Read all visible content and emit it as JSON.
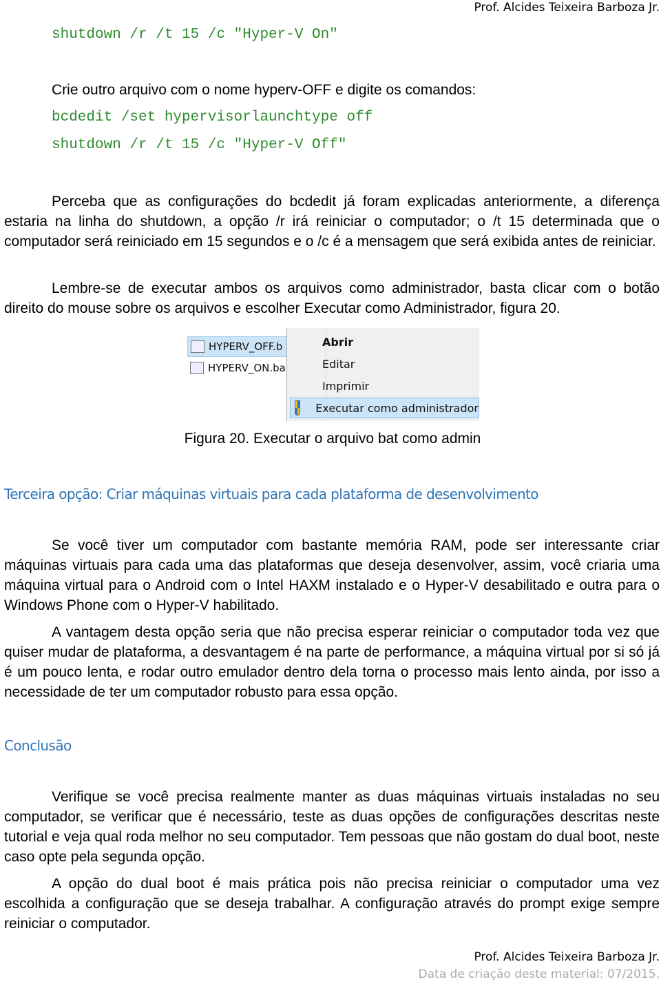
{
  "header": {
    "author": "Prof. Alcides Teixeira Barboza Jr."
  },
  "code_block_1": [
    "shutdown /r /t 15 /c \"Hyper-V On\""
  ],
  "intro_off": "Crie outro arquivo com o nome hyperv-OFF e digite os comandos:",
  "code_block_2": [
    "bcdedit /set hypervisorlaunchtype off",
    "shutdown /r /t 15 /c \"Hyper-V Off\""
  ],
  "paragraphs_1": [
    "Perceba que as configurações do bcdedit já foram explicadas anteriormente, a diferença estaria na linha do shutdown, a opção /r irá reiniciar o computador; o /t 15 determinada que o computador será reiniciado em 15 segundos e o /c é a mensagem que será exibida antes de reiniciar.",
    "Lembre-se de executar ambos os arquivos como administrador, basta clicar com o botão direito do mouse sobre os arquivos e escolher Executar como Administrador, figura 20."
  ],
  "figure": {
    "files": [
      "HYPERV_OFF.b",
      "HYPERV_ON.ba"
    ],
    "menu_items": [
      "Abrir",
      "Editar",
      "Imprimir",
      "Executar como administrador"
    ],
    "caption": "Figura 20. Executar o arquivo bat como admin"
  },
  "section_3": {
    "heading": "Terceira opção: Criar máquinas virtuais para cada plataforma de desenvolvimento",
    "paragraphs": [
      "Se você tiver um computador com bastante memória RAM, pode ser interessante criar máquinas virtuais para cada uma das plataformas que deseja desenvolver, assim, você criaria uma máquina virtual para o Android com o Intel HAXM instalado e o Hyper-V desabilitado e outra para o Windows Phone com o Hyper-V habilitado.",
      "A vantagem desta opção seria que não precisa esperar reiniciar o computador toda vez que quiser mudar de plataforma, a desvantagem é na parte de performance, a máquina virtual por si só já é um pouco lenta, e rodar outro emulador dentro dela torna o processo mais lento ainda, por isso a necessidade de ter um computador robusto para essa opção."
    ]
  },
  "conclusion": {
    "heading": "Conclusão",
    "paragraphs": [
      "Verifique se você precisa realmente manter as duas máquinas virtuais instaladas no seu computador, se verificar que é necessário, teste as duas opções de configurações descritas neste tutorial e veja qual roda melhor no seu computador. Tem pessoas que não gostam do dual boot, neste caso opte pela segunda opção.",
      "A opção do dual boot é mais prática pois não precisa reiniciar o computador uma vez escolhida a configuração que se deseja trabalhar. A configuração através do prompt exige sempre reiniciar o computador."
    ]
  },
  "footer": {
    "author": "Prof. Alcides Teixeira Barboza Jr.",
    "date": "Data de criação deste material: 07/2015."
  },
  "colors": {
    "code": "#2e8b2e",
    "heading": "#2e74b5",
    "footer_date": "#aaaaaa"
  }
}
